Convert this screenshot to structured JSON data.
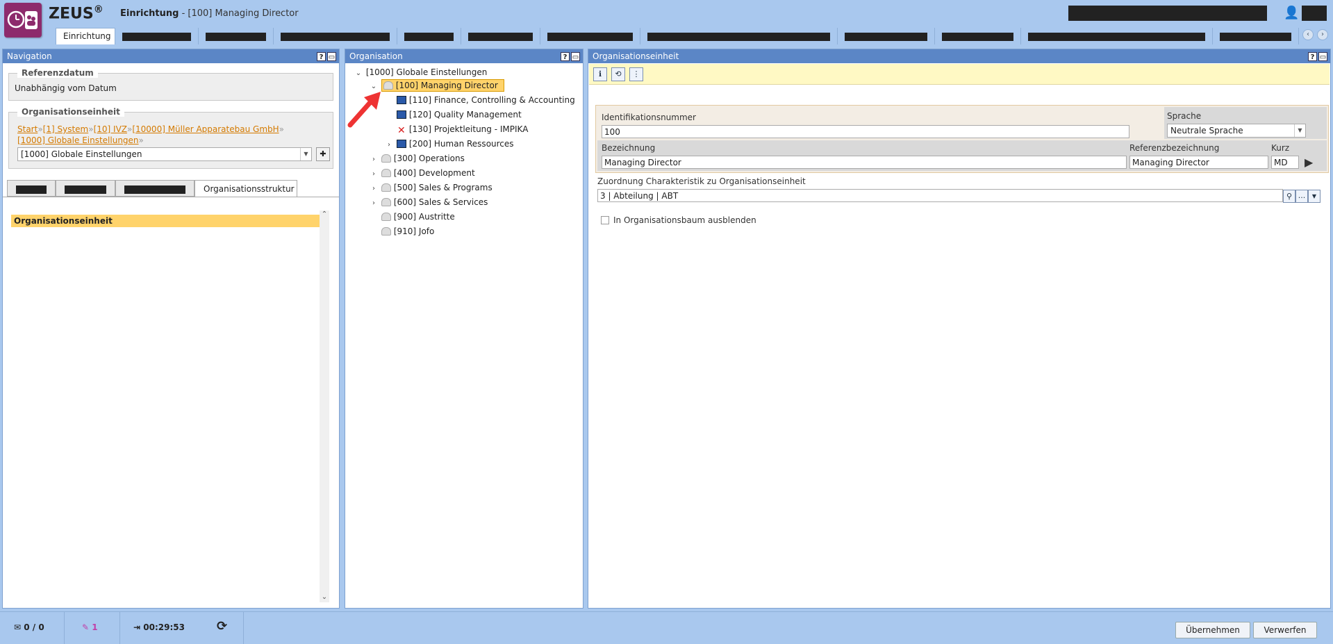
{
  "app": {
    "brand": "ZEUS",
    "brand_mark": "®",
    "module": "Einrichtung",
    "subtitle": "- [100] Managing Director"
  },
  "tabs": {
    "active_label": "Einrichtung"
  },
  "navigation": {
    "title": "Navigation",
    "referenzdatum_label": "Referenzdatum",
    "referenzdatum_value": "Unabhängig vom Datum",
    "orgeinheit_label": "Organisationseinheit",
    "breadcrumb": [
      "Start",
      "[1] System",
      "[10] IVZ",
      "[10000] Müller Apparatebau GmbH",
      "[1000] Globale Einstellungen"
    ],
    "breadcrumb_sep": "»",
    "selected_unit": "[1000] Globale Einstellungen",
    "active_tab": "Organisationsstruktur",
    "list_header": "Organisationseinheit"
  },
  "organisation": {
    "title": "Organisation",
    "tree": [
      {
        "label": "[1000] Globale Einstellungen",
        "twisty": "⌄"
      },
      {
        "label": "[100] Managing Director",
        "twisty": "⌄"
      },
      {
        "label": "[110] Finance, Controlling & Accounting",
        "twisty": ""
      },
      {
        "label": "[120] Quality Management",
        "twisty": ""
      },
      {
        "label": "[130] Projektleitung - IMPIKA",
        "twisty": ""
      },
      {
        "label": "[200] Human Ressources",
        "twisty": "›"
      },
      {
        "label": "[300] Operations",
        "twisty": "›"
      },
      {
        "label": "[400] Development",
        "twisty": "›"
      },
      {
        "label": "[500] Sales & Programs",
        "twisty": "›"
      },
      {
        "label": "[600] Sales & Services",
        "twisty": "›"
      },
      {
        "label": "[900] Austritte",
        "twisty": ""
      },
      {
        "label": "[910] Jofo",
        "twisty": ""
      }
    ]
  },
  "detail": {
    "title": "Organisationseinheit",
    "id_label": "Identifikationsnummer",
    "id_value": "100",
    "sprache_label": "Sprache",
    "sprache_value": "Neutrale Sprache",
    "bezeichnung_label": "Bezeichnung",
    "bezeichnung_value": "Managing Director",
    "referenz_label": "Referenzbezeichnung",
    "referenz_value": "Managing Director",
    "kurz_label": "Kurz",
    "kurz_value": "MD",
    "zuordnung_label": "Zuordnung Charakteristik zu Organisationseinheit",
    "zuordnung_value": "3 | Abteilung | ABT",
    "ausblenden_label": "In Organisationsbaum ausblenden",
    "ellipsis": "..."
  },
  "footer": {
    "messages": "0 / 0",
    "edits": "1",
    "session_time": "00:29:53",
    "apply_label": "Übernehmen",
    "discard_label": "Verwerfen"
  },
  "icons": {
    "help": "?",
    "pin": "📌",
    "user": "👤",
    "refresh": "⟳"
  },
  "colors": {
    "accent": "#5b86c6",
    "selection": "#ffd36b",
    "brand": "#8d2b6c",
    "link": "#d47a00"
  }
}
